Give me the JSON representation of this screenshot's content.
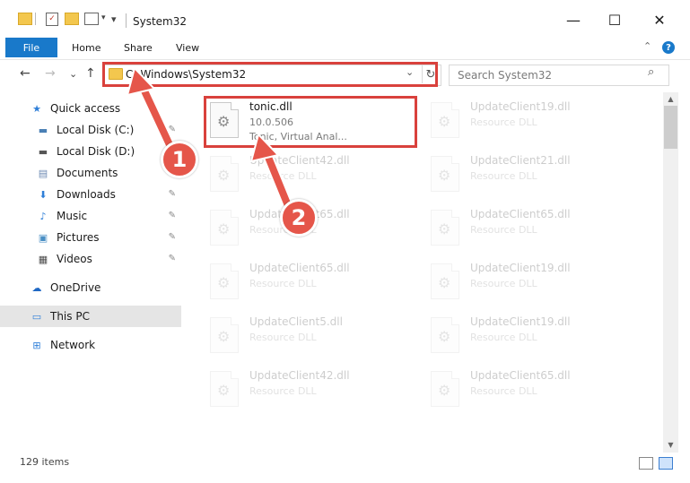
{
  "window": {
    "title": "System32",
    "minimize_glyph": "—",
    "maximize_glyph": "☐",
    "close_glyph": "✕"
  },
  "ribbon": {
    "file_label": "File",
    "tabs": [
      "Home",
      "Share",
      "View"
    ],
    "help_glyph": "?"
  },
  "nav": {
    "back_glyph": "←",
    "forward_glyph": "→",
    "recent_glyph": "⌄",
    "up_glyph": "↑",
    "address": "C:\\Windows\\System32",
    "dropdown_glyph": "⌄",
    "refresh_glyph": "↻",
    "search_placeholder": "Search System32",
    "search_glyph": "⌕"
  },
  "sidebar": {
    "items": [
      {
        "label": "Quick access",
        "icon": "star-icon",
        "glyph": "★",
        "color": "#2f7fd8"
      },
      {
        "label": "Local Disk (C:)",
        "icon": "drive-c-icon",
        "glyph": "▬",
        "color": "#4a7fb5"
      },
      {
        "label": "Local Disk (D:)",
        "icon": "drive-d-icon",
        "glyph": "▬",
        "color": "#555555"
      },
      {
        "label": "Documents",
        "icon": "documents-icon",
        "glyph": "▤",
        "color": "#6c8ab3"
      },
      {
        "label": "Downloads",
        "icon": "downloads-icon",
        "glyph": "⬇",
        "color": "#2f7fd8"
      },
      {
        "label": "Music",
        "icon": "music-icon",
        "glyph": "♪",
        "color": "#2f7fd8"
      },
      {
        "label": "Pictures",
        "icon": "pictures-icon",
        "glyph": "▣",
        "color": "#4a8fc4"
      },
      {
        "label": "Videos",
        "icon": "videos-icon",
        "glyph": "▦",
        "color": "#4a4a4a"
      },
      {
        "label": "OneDrive",
        "icon": "onedrive-icon",
        "glyph": "☁",
        "color": "#1f68c4"
      },
      {
        "label": "This PC",
        "icon": "this-pc-icon",
        "glyph": "▭",
        "color": "#2f7fd8"
      },
      {
        "label": "Network",
        "icon": "network-icon",
        "glyph": "⊞",
        "color": "#2f7fd8"
      }
    ],
    "pin_glyph": "✎"
  },
  "files": [
    {
      "name": "tonic.dll",
      "desc": "10.0.506",
      "sub": "Tonic, Virtual Anal..."
    },
    {
      "name": "UpdateClient19.dll",
      "desc": "Resource DLL"
    },
    {
      "name": "UpdateClient42.dll",
      "desc": "Resource DLL"
    },
    {
      "name": "UpdateClient21.dll",
      "desc": "Resource DLL"
    },
    {
      "name": "UpdateClient65.dll",
      "desc": "Resource DLL"
    },
    {
      "name": "UpdateClient65.dll",
      "desc": "Resource DLL"
    },
    {
      "name": "UpdateClient65.dll",
      "desc": "Resource DLL"
    },
    {
      "name": "UpdateClient19.dll",
      "desc": "Resource DLL"
    },
    {
      "name": "UpdateClient5.dll",
      "desc": "Resource DLL"
    },
    {
      "name": "UpdateClient19.dll",
      "desc": "Resource DLL"
    },
    {
      "name": "UpdateClient42.dll",
      "desc": "Resource DLL"
    },
    {
      "name": "UpdateClient65.dll",
      "desc": "Resource DLL"
    }
  ],
  "gear_glyph": "⚙",
  "status": {
    "item_count": "129 items"
  },
  "annotations": {
    "step1": "1",
    "step2": "2",
    "color": "#e5564a"
  },
  "scroll": {
    "up_glyph": "▲",
    "down_glyph": "▼"
  }
}
